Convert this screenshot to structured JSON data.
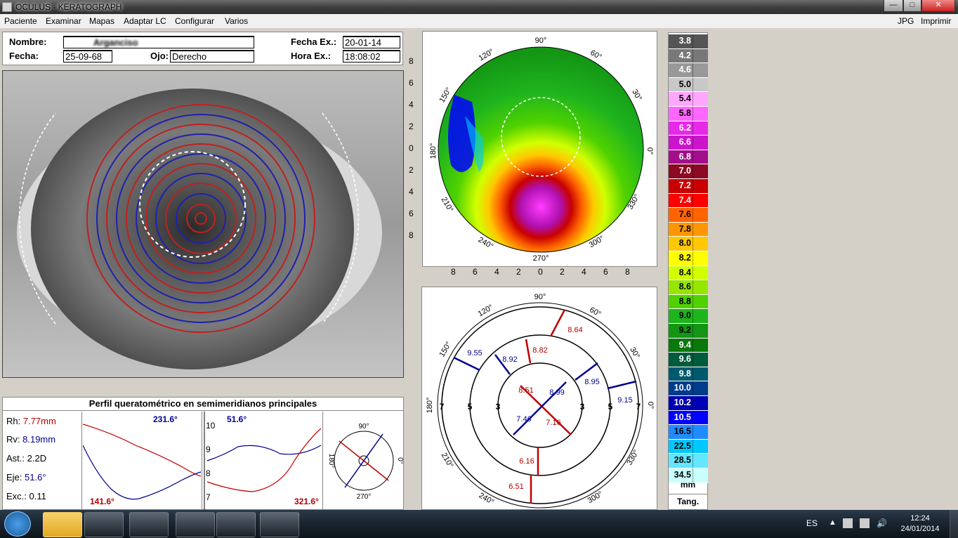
{
  "window": {
    "title": "OCULUS  -  KERATOGRAPH",
    "min": "—",
    "max": "□",
    "close": "✕"
  },
  "menu": {
    "items": [
      "Paciente",
      "Examinar",
      "Mapas",
      "Adaptar LC",
      "Configurar",
      "Varios"
    ],
    "right": [
      "JPG",
      "Imprimir"
    ]
  },
  "patient": {
    "nombre_label": "Nombre:",
    "nombre_value": "Arganciso",
    "fecha_label": "Fecha:",
    "fecha_value": "25-09-68",
    "ojo_label": "Ojo:",
    "ojo_value": "Derecho",
    "fecha_ex_label": "Fecha Ex.:",
    "fecha_ex_value": "20-01-14",
    "hora_ex_label": "Hora Ex.:",
    "hora_ex_value": "18:08:02"
  },
  "topo_map": {
    "angles": [
      "90°",
      "60°",
      "30°",
      "0°",
      "330°",
      "300°",
      "270°",
      "240°",
      "210°",
      "180°",
      "150°",
      "120°"
    ],
    "y_ticks": [
      "8",
      "6",
      "4",
      "2",
      "0",
      "2",
      "4",
      "6",
      "8"
    ],
    "x_ticks": [
      "8",
      "6",
      "4",
      "2",
      "0",
      "2",
      "4",
      "6",
      "8"
    ]
  },
  "color_scale": {
    "values": [
      "3.8",
      "4.2",
      "4.6",
      "5.0",
      "5.4",
      "5.8",
      "6.2",
      "6.6",
      "6.8",
      "7.0",
      "7.2",
      "7.4",
      "7.6",
      "7.8",
      "8.0",
      "8.2",
      "8.4",
      "8.6",
      "8.8",
      "9.0",
      "9.2",
      "9.4",
      "9.6",
      "9.8",
      "10.0",
      "10.2",
      "10.5",
      "16.5",
      "22.5",
      "28.5",
      "34.5"
    ],
    "colors": [
      "#555555",
      "#787878",
      "#999999",
      "#c8c8c8",
      "#ffa6ff",
      "#ff66ff",
      "#e629e6",
      "#cc14cc",
      "#a30e8c",
      "#8c0a24",
      "#c80000",
      "#ff0000",
      "#ff6400",
      "#ff9600",
      "#ffc800",
      "#ffff00",
      "#d2ff00",
      "#96e600",
      "#50d200",
      "#1eb41e",
      "#149614",
      "#0a780a",
      "#005a3c",
      "#005a6e",
      "#003c8c",
      "#0000b4",
      "#0000ff",
      "#1e8cff",
      "#00c8ff",
      "#64e6ff",
      "#c8ffff"
    ],
    "text_white": [
      true,
      true,
      true,
      false,
      false,
      false,
      true,
      true,
      true,
      true,
      true,
      true,
      false,
      false,
      false,
      false,
      false,
      false,
      false,
      false,
      false,
      true,
      true,
      true,
      true,
      true,
      true,
      false,
      false,
      false,
      false
    ],
    "unit": "mm",
    "mode": "Tang."
  },
  "kerato_diagram": {
    "angles": [
      "90°",
      "60°",
      "30°",
      "0°",
      "330°",
      "300°",
      "270°",
      "240°",
      "210°",
      "180°",
      "150°",
      "120°"
    ],
    "ring_labels": [
      "7",
      "5",
      "3",
      "3",
      "5",
      "7"
    ],
    "values": [
      {
        "text": "8.64",
        "color": "#b00000"
      },
      {
        "text": "9.55",
        "color": "#000090"
      },
      {
        "text": "8.82",
        "color": "#b00000"
      },
      {
        "text": "8.92",
        "color": "#000090"
      },
      {
        "text": "8.95",
        "color": "#000090"
      },
      {
        "text": "9.15",
        "color": "#000090"
      },
      {
        "text": "8.51",
        "color": "#b00000"
      },
      {
        "text": "8.99",
        "color": "#000090"
      },
      {
        "text": "7.46",
        "color": "#000090"
      },
      {
        "text": "7.16",
        "color": "#b00000"
      },
      {
        "text": "6.16",
        "color": "#b00000"
      },
      {
        "text": "6.51",
        "color": "#b00000"
      }
    ]
  },
  "profile": {
    "title": "Perfil queratométrico en semimeridianos principales",
    "rows": [
      {
        "label": "Rh:",
        "value": "7.77mm",
        "color": "#b00000"
      },
      {
        "label": "Rv:",
        "value": "8.19mm",
        "color": "#000090"
      },
      {
        "label": "Ast.:",
        "value": "2.2D",
        "color": "#000000"
      },
      {
        "label": "Eje:",
        "value": "51.6°",
        "color": "#000090"
      },
      {
        "label": "Exc.:",
        "value": "0.11",
        "color": "#000000"
      }
    ],
    "chart1": {
      "top_label": "231.6°",
      "bottom_label": "141.6°"
    },
    "chart2": {
      "top_label": "51.6°",
      "bottom_label": "321.6°",
      "y_ticks": [
        "10",
        "9",
        "8",
        "7"
      ]
    },
    "mini_dial": {
      "top": "90°",
      "left": "180°",
      "right": "0°",
      "bottom": "270°"
    }
  },
  "taskbar": {
    "lang": "ES",
    "time": "12:24",
    "date": "24/01/2014"
  }
}
